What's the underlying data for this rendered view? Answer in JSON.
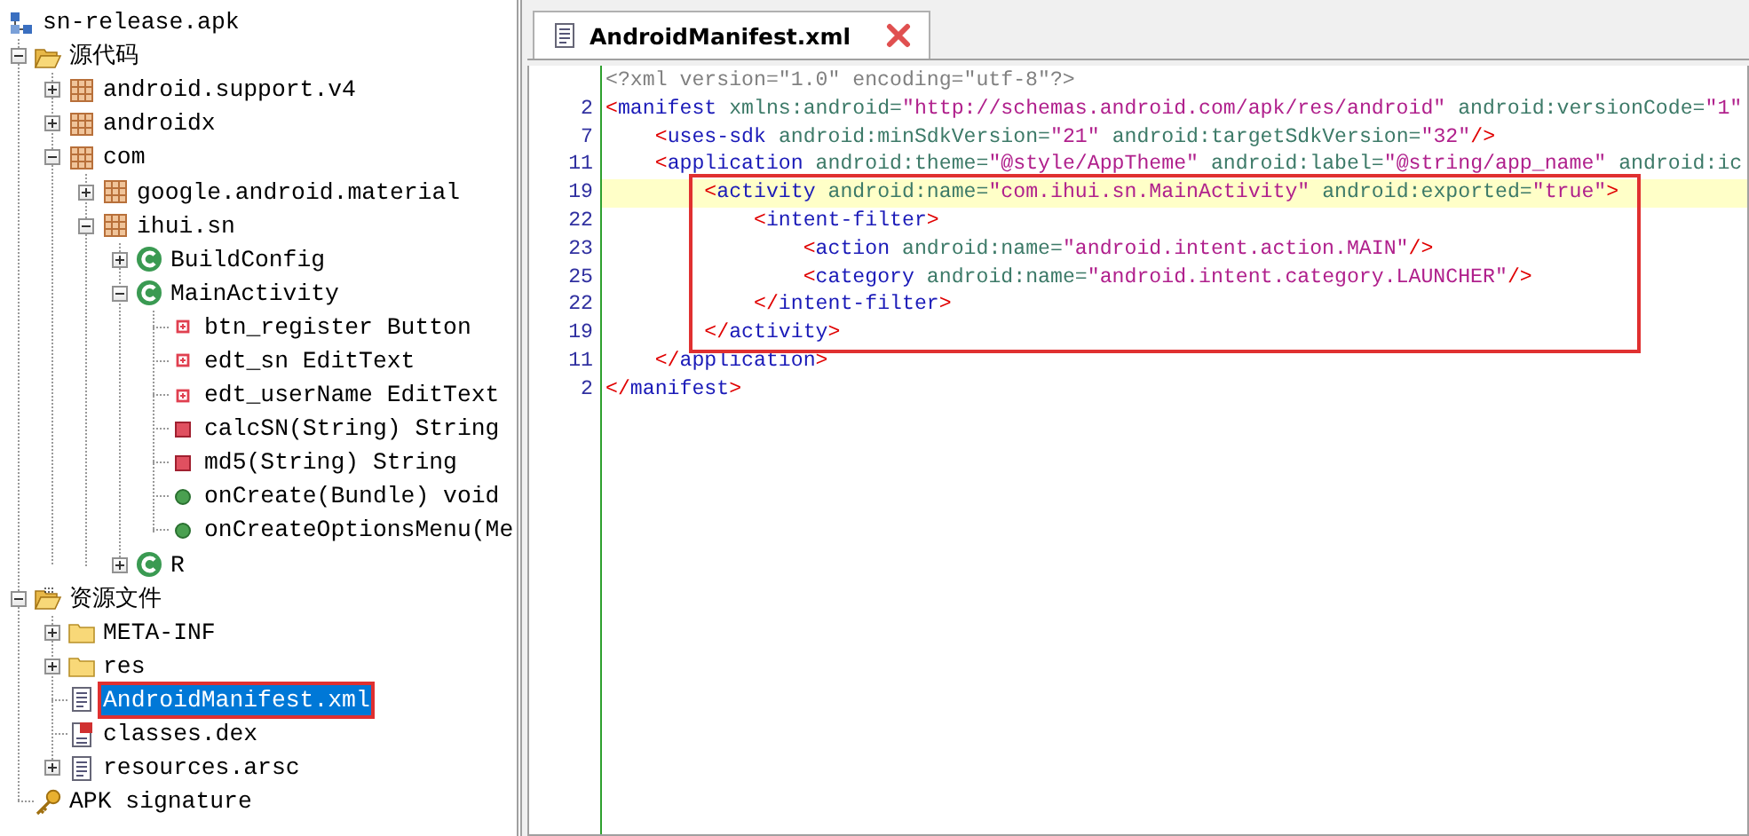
{
  "tree": {
    "items": [
      {
        "label": "sn-release.apk",
        "kind": "apk",
        "selected": false,
        "annotated": false,
        "children": [
          {
            "label": "源代码",
            "kind": "source-folder",
            "expanded": true,
            "selected": false,
            "annotated": false,
            "children": [
              {
                "label": "android.support.v4",
                "kind": "package",
                "expanded": false,
                "selected": false,
                "annotated": false
              },
              {
                "label": "androidx",
                "kind": "package",
                "expanded": false,
                "selected": false,
                "annotated": false
              },
              {
                "label": "com",
                "kind": "package",
                "expanded": true,
                "selected": false,
                "annotated": false,
                "children": [
                  {
                    "label": "google.android.material",
                    "kind": "package",
                    "expanded": false,
                    "selected": false,
                    "annotated": false
                  },
                  {
                    "label": "ihui.sn",
                    "kind": "package",
                    "expanded": true,
                    "selected": false,
                    "annotated": false,
                    "children": [
                      {
                        "label": "BuildConfig",
                        "kind": "class",
                        "expanded": false,
                        "selected": false,
                        "annotated": false
                      },
                      {
                        "label": "MainActivity",
                        "kind": "class",
                        "expanded": true,
                        "selected": false,
                        "annotated": false,
                        "children": [
                          {
                            "label": "btn_register Button",
                            "kind": "field",
                            "selected": false,
                            "annotated": false
                          },
                          {
                            "label": "edt_sn EditText",
                            "kind": "field",
                            "selected": false,
                            "annotated": false
                          },
                          {
                            "label": "edt_userName EditText",
                            "kind": "field",
                            "selected": false,
                            "annotated": false
                          },
                          {
                            "label": "calcSN(String) String",
                            "kind": "private-method",
                            "selected": false,
                            "annotated": false
                          },
                          {
                            "label": "md5(String) String",
                            "kind": "private-method",
                            "selected": false,
                            "annotated": false
                          },
                          {
                            "label": "onCreate(Bundle) void",
                            "kind": "public-method",
                            "selected": false,
                            "annotated": false
                          },
                          {
                            "label": "onCreateOptionsMenu(Me",
                            "kind": "public-method",
                            "selected": false,
                            "annotated": false
                          }
                        ]
                      },
                      {
                        "label": "R",
                        "kind": "class",
                        "expanded": false,
                        "selected": false,
                        "annotated": false
                      }
                    ]
                  }
                ]
              }
            ]
          },
          {
            "label": "资源文件",
            "kind": "resource-folder",
            "expanded": true,
            "selected": false,
            "annotated": false,
            "children": [
              {
                "label": "META-INF",
                "kind": "folder",
                "expanded": false,
                "selected": false,
                "annotated": false
              },
              {
                "label": "res",
                "kind": "folder",
                "expanded": false,
                "selected": false,
                "annotated": false
              },
              {
                "label": "AndroidManifest.xml",
                "kind": "document",
                "selected": true,
                "annotated": true
              },
              {
                "label": "classes.dex",
                "kind": "dex-file",
                "selected": false,
                "annotated": false
              },
              {
                "label": "resources.arsc",
                "kind": "document",
                "expanded": false,
                "selected": false,
                "annotated": false
              }
            ]
          },
          {
            "label": "APK signature",
            "kind": "key",
            "selected": false,
            "annotated": false
          }
        ]
      }
    ]
  },
  "editor": {
    "tab": {
      "label": "AndroidManifest.xml"
    },
    "lines": [
      {
        "kind": "line",
        "highlighted": false,
        "tokens": [
          {
            "kind": "prolog",
            "text": "<?xml version=\"1.0\" encoding=\"utf-8\"?>"
          }
        ]
      },
      {
        "kind": "line",
        "number": "2",
        "highlighted": false,
        "tokens": [
          {
            "kind": "bracket",
            "text": "<"
          },
          {
            "kind": "tag",
            "text": "manifest"
          },
          {
            "kind": "attr",
            "text": " xmlns:android="
          },
          {
            "kind": "value",
            "text": "\"http://schemas.android.com/apk/res/android\""
          },
          {
            "kind": "attr",
            "text": " android:versionCode="
          },
          {
            "kind": "value",
            "text": "\"1\""
          }
        ]
      },
      {
        "kind": "line",
        "number": "7",
        "highlighted": false,
        "tokens": [
          {
            "kind": "bracket",
            "text": "    <"
          },
          {
            "kind": "tag",
            "text": "uses-sdk"
          },
          {
            "kind": "attr",
            "text": " android:minSdkVersion="
          },
          {
            "kind": "value",
            "text": "\"21\""
          },
          {
            "kind": "attr",
            "text": " android:targetSdkVersion="
          },
          {
            "kind": "value",
            "text": "\"32\""
          },
          {
            "kind": "bracket",
            "text": "/>"
          }
        ]
      },
      {
        "kind": "line",
        "number": "11",
        "highlighted": false,
        "tokens": [
          {
            "kind": "bracket",
            "text": "    <"
          },
          {
            "kind": "tag",
            "text": "application"
          },
          {
            "kind": "attr",
            "text": " android:theme="
          },
          {
            "kind": "value",
            "text": "\"@style/AppTheme\""
          },
          {
            "kind": "attr",
            "text": " android:label="
          },
          {
            "kind": "value",
            "text": "\"@string/app_name\""
          },
          {
            "kind": "attr",
            "text": " android:ic"
          }
        ]
      },
      {
        "kind": "annotation",
        "lines": [
          {
            "kind": "line",
            "number": "19",
            "highlighted": true,
            "tokens": [
              {
                "kind": "bracket",
                "text": "        <"
              },
              {
                "kind": "tag",
                "text": "activity"
              },
              {
                "kind": "attr",
                "text": " android:name="
              },
              {
                "kind": "value",
                "text": "\"com.ihui.sn.MainActivity\""
              },
              {
                "kind": "attr",
                "text": " android:exported="
              },
              {
                "kind": "value",
                "text": "\"true\""
              },
              {
                "kind": "bracket",
                "text": ">"
              }
            ]
          },
          {
            "kind": "line",
            "number": "22",
            "highlighted": false,
            "tokens": [
              {
                "kind": "bracket",
                "text": "            <"
              },
              {
                "kind": "tag",
                "text": "intent-filter"
              },
              {
                "kind": "bracket",
                "text": ">"
              }
            ]
          },
          {
            "kind": "line",
            "number": "23",
            "highlighted": false,
            "tokens": [
              {
                "kind": "bracket",
                "text": "                <"
              },
              {
                "kind": "tag",
                "text": "action"
              },
              {
                "kind": "attr",
                "text": " android:name="
              },
              {
                "kind": "value",
                "text": "\"android.intent.action.MAIN\""
              },
              {
                "kind": "bracket",
                "text": "/>"
              }
            ]
          },
          {
            "kind": "line",
            "number": "25",
            "highlighted": false,
            "tokens": [
              {
                "kind": "bracket",
                "text": "                <"
              },
              {
                "kind": "tag",
                "text": "category"
              },
              {
                "kind": "attr",
                "text": " android:name="
              },
              {
                "kind": "value",
                "text": "\"android.intent.category.LAUNCHER\""
              },
              {
                "kind": "bracket",
                "text": "/>"
              }
            ]
          },
          {
            "kind": "line",
            "number": "22",
            "highlighted": false,
            "tokens": [
              {
                "kind": "bracket",
                "text": "            </"
              },
              {
                "kind": "tag",
                "text": "intent-filter"
              },
              {
                "kind": "bracket",
                "text": ">"
              }
            ]
          },
          {
            "kind": "line",
            "number": "19",
            "highlighted": false,
            "tokens": [
              {
                "kind": "bracket",
                "text": "        </"
              },
              {
                "kind": "tag",
                "text": "activity"
              },
              {
                "kind": "bracket",
                "text": ">"
              }
            ]
          }
        ]
      },
      {
        "kind": "line",
        "number": "11",
        "highlighted": false,
        "tokens": [
          {
            "kind": "bracket",
            "text": "    </"
          },
          {
            "kind": "tag",
            "text": "application"
          },
          {
            "kind": "bracket",
            "text": ">"
          }
        ]
      },
      {
        "kind": "line",
        "number": "2",
        "highlighted": false,
        "tokens": [
          {
            "kind": "bracket",
            "text": "</"
          },
          {
            "kind": "tag",
            "text": "manifest"
          },
          {
            "kind": "bracket",
            "text": ">"
          }
        ]
      }
    ]
  }
}
